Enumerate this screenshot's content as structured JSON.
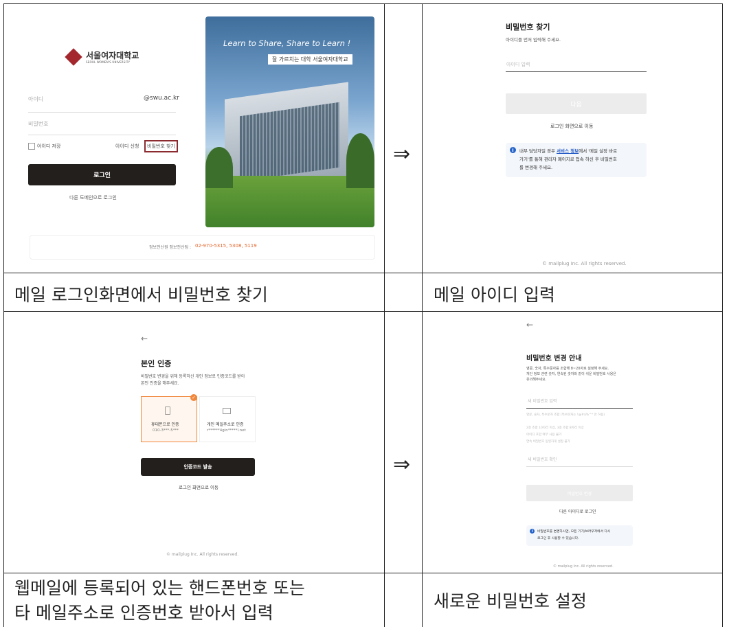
{
  "arrow": "⇒",
  "captions": {
    "c1": "메일 로그인화면에서 비밀번호 찾기",
    "c2": "메일 아이디 입력",
    "c3_line1": "웹메일에 등록되어 있는 핸드폰번호 또는",
    "c3_line2": "타 메일주소로 인증번호 받아서 입력",
    "c4": "새로운 비밀번호 설정"
  },
  "login": {
    "univ_name_ko": "서울여자대학교",
    "univ_name_en": "SEOUL WOMEN'S UNIVERSITY",
    "id_placeholder": "아이디",
    "domain": "@swu.ac.kr",
    "pw_placeholder": "비밀번호",
    "save_id": "아이디 저장",
    "apply_id": "아이디 신청",
    "find_pw": "비밀번호 찾기",
    "login_btn": "로그인",
    "other_domain": "다른 도메인으로 로그인",
    "banner_slogan": "Learn to Share, Share to Learn !",
    "banner_sub": "잘 가르치는 대학 서울여자대학교",
    "contact_label": "정보전산원 정보전산팀 : ",
    "contact_number": "02-970-5315, 5308, 5119"
  },
  "find": {
    "title": "비밀번호 찾기",
    "desc": "아이디를 먼저 입력해 주세요.",
    "id_placeholder": "아이디 입력",
    "next_btn": "다음",
    "to_login": "로그인 화면으로 이동",
    "info_pre": "내부 담당자일 경우 ",
    "info_link": "서비스 정보",
    "info_post1": "에서 '메일 설정 바로",
    "info_line2": "가기'를 통해 관리자 페이지로 접속 하신 후 비밀번호",
    "info_line3": "를 변경해 주세요.",
    "copyright": "© mailplug Inc. All rights reserved."
  },
  "verify": {
    "back": "←",
    "title": "본인 인증",
    "desc1": "비밀번호 변경을 위해 등록하신 개인 정보로 인증코드를 받아",
    "desc2": "본인 인증을 해주세요.",
    "phone_label": "휴대폰으로 인증",
    "phone_value": "010-3***-5***",
    "email_label": "개인 메일주소로 인증",
    "email_value": "r******4gin*****l.net",
    "send_btn": "인증코드 발송",
    "to_login": "로그인 화면으로 이동",
    "copyright": "© mailplug Inc. All rights reserved."
  },
  "change": {
    "back": "←",
    "title": "비밀번호 변경 안내",
    "desc1": "영문, 숫자, 특수문자를 조합해 8~20자로 설정해 주세요.",
    "desc2": "개인 정보 관련 숫자, 연속된 숫자와 같이 쉬운 비밀번호 사용은",
    "desc3": "유의해주세요.",
    "new_pw_placeholder": "새 비밀번호 입력",
    "rules": [
      "영문, 숫자, 특수문자 조합 (특수문자는 !@#$%^* 만 허용)",
      "2종 조합 10자리 이상, 3종 조합 8자리 이상",
      "아이디 포함 여부 사용 불가",
      "연속 비밀번호 동일하게 설정 불가"
    ],
    "confirm_placeholder": "새 비밀번호 확인",
    "change_btn": "비밀번호 변경",
    "other_id": "다른 아이디로 로그인",
    "info_line1": "비밀번호를 변경하시면, 모든 기기/브라우저에서 다시",
    "info_line2": "로그인 후 사용할 수 있습니다.",
    "copyright": "© mailplug Inc. All rights reserved."
  },
  "colors": {
    "dark_button": "#231f1c",
    "brand_red": "#a3272d",
    "accent_orange": "#f0873a",
    "link_blue": "#1f56c4"
  }
}
